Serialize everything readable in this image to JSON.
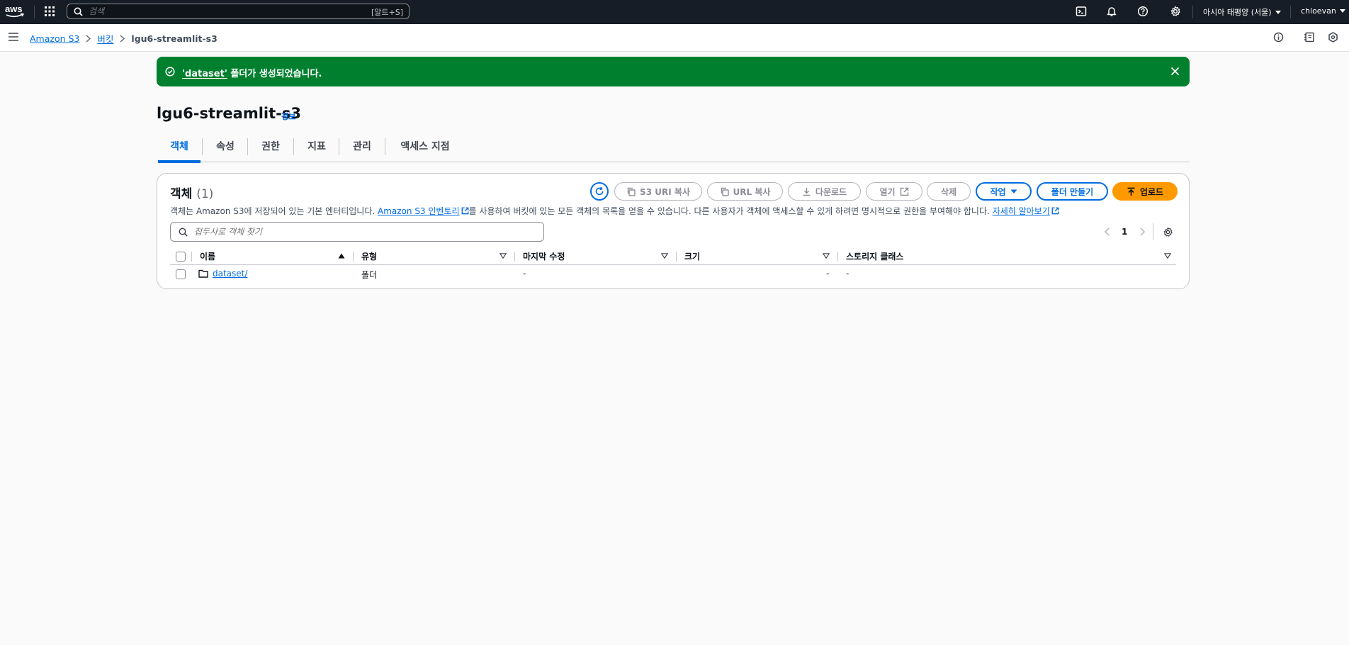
{
  "topnav": {
    "search_placeholder": "검색",
    "search_shortcut": "[알트+S]",
    "region": "아시아 태평양 (서울)",
    "user": "chloevan",
    "icons": [
      "cloudshell-icon",
      "bell-icon",
      "help-icon",
      "settings-icon"
    ]
  },
  "breadcrumb": {
    "items": [
      "Amazon S3",
      "버킷",
      "lgu6-streamlit-s3"
    ]
  },
  "flash": {
    "name": "'dataset'",
    "text": " 폴더가 생성되었습니다.",
    "color": "#00802f"
  },
  "header": {
    "title": "lgu6-streamlit-s3",
    "info": "정보"
  },
  "tabs": [
    {
      "label": "객체"
    },
    {
      "label": "속성"
    },
    {
      "label": "권한"
    },
    {
      "label": "지표"
    },
    {
      "label": "관리"
    },
    {
      "label": "액세스 지점"
    }
  ],
  "objects": {
    "title": "객체",
    "count": "(1)",
    "actions": {
      "copy_s3_uri": "S3 URI 복사",
      "copy_url": "URL 복사",
      "download": "다운로드",
      "open": "열기",
      "delete": "삭제",
      "actions": "작업",
      "create_folder": "폴더 만들기",
      "upload": "업로드"
    },
    "desc_part1": "객체는 Amazon S3에 저장되어 있는 기본 엔터티입니다. ",
    "desc_link1": "Amazon S3 인벤토리",
    "desc_part2": "를 사용하여 버킷에 있는 모든 객체의 목록을 얻을 수 있습니다. 다른 사용자가 객체에 액세스할 수 있게 하려면 명시적으로 권한을 부여해야 합니다. ",
    "desc_link2": "자세히 알아보기",
    "filter_placeholder": "접두사로 객체 찾기",
    "page": "1",
    "columns": [
      "이름",
      "유형",
      "마지막 수정",
      "크기",
      "스토리지 클래스"
    ],
    "rows": [
      {
        "name": "dataset/",
        "type": "폴더",
        "modified": "-",
        "size": "-",
        "storage": "-"
      }
    ]
  },
  "colors": {
    "accent": "#006ce0",
    "primary_button": "#ff9900",
    "topnav": "#161d26"
  }
}
